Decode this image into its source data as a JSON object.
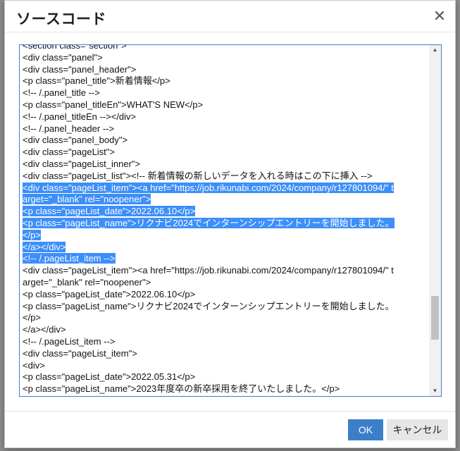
{
  "dialog": {
    "title": "ソースコード",
    "close_glyph": "✕",
    "ok_label": "OK",
    "cancel_label": "キャンセル"
  },
  "editor": {
    "lines": [
      {
        "text": "<section class=\"section\">",
        "selected": false
      },
      {
        "text": "<div class=\"panel\">",
        "selected": false
      },
      {
        "text": "<div class=\"panel_header\">",
        "selected": false
      },
      {
        "text": "<p class=\"panel_title\">新着情報</p>",
        "selected": false
      },
      {
        "text": "<!-- /.panel_title -->",
        "selected": false
      },
      {
        "text": "<p class=\"panel_titleEn\">WHAT'S NEW</p>",
        "selected": false
      },
      {
        "text": "<!-- /.panel_titleEn --></div>",
        "selected": false
      },
      {
        "text": "<!-- /.panel_header -->",
        "selected": false
      },
      {
        "text": "<div class=\"panel_body\">",
        "selected": false
      },
      {
        "text": "<div class=\"pageList\">",
        "selected": false
      },
      {
        "text": "<div class=\"pageList_inner\">",
        "selected": false
      },
      {
        "text": "<div class=\"pageList_list\"><!-- 新着情報の新しいデータを入れる時はこの下に挿入 -->",
        "selected": false
      },
      {
        "text": "<div class=\"pageList_item\"><a href=\"https://job.rikunabi.com/2024/company/r127801094/\" t",
        "selected": true
      },
      {
        "text": "arget=\"_blank\" rel=\"noopener\">",
        "selected": true
      },
      {
        "text": "<p class=\"pageList_date\">2022.06.10</p>",
        "selected": true
      },
      {
        "text": "<p class=\"pageList_name\">リクナビ2024でインターンシップエントリーを開始しました。",
        "selected": true
      },
      {
        "text": "</p>",
        "selected": true
      },
      {
        "text": "</a></div>",
        "selected": true
      },
      {
        "text": "<!-- /.pageList_item -->",
        "selected": true
      },
      {
        "text": "<div class=\"pageList_item\"><a href=\"https://job.rikunabi.com/2024/company/r127801094/\" t",
        "selected": false
      },
      {
        "text": "arget=\"_blank\" rel=\"noopener\">",
        "selected": false
      },
      {
        "text": "<p class=\"pageList_date\">2022.06.10</p>",
        "selected": false
      },
      {
        "text": "<p class=\"pageList_name\">リクナビ2024でインターンシップエントリーを開始しました。",
        "selected": false
      },
      {
        "text": "</p>",
        "selected": false
      },
      {
        "text": "</a></div>",
        "selected": false
      },
      {
        "text": "<!-- /.pageList_item -->",
        "selected": false
      },
      {
        "text": "<div class=\"pageList_item\">",
        "selected": false
      },
      {
        "text": "<div>",
        "selected": false
      },
      {
        "text": "<p class=\"pageList_date\">2022.05.31</p>",
        "selected": false
      },
      {
        "text": "<p class=\"pageList_name\">2023年度卒の新卒採用を終了いたしました。</p>",
        "selected": false
      }
    ]
  }
}
